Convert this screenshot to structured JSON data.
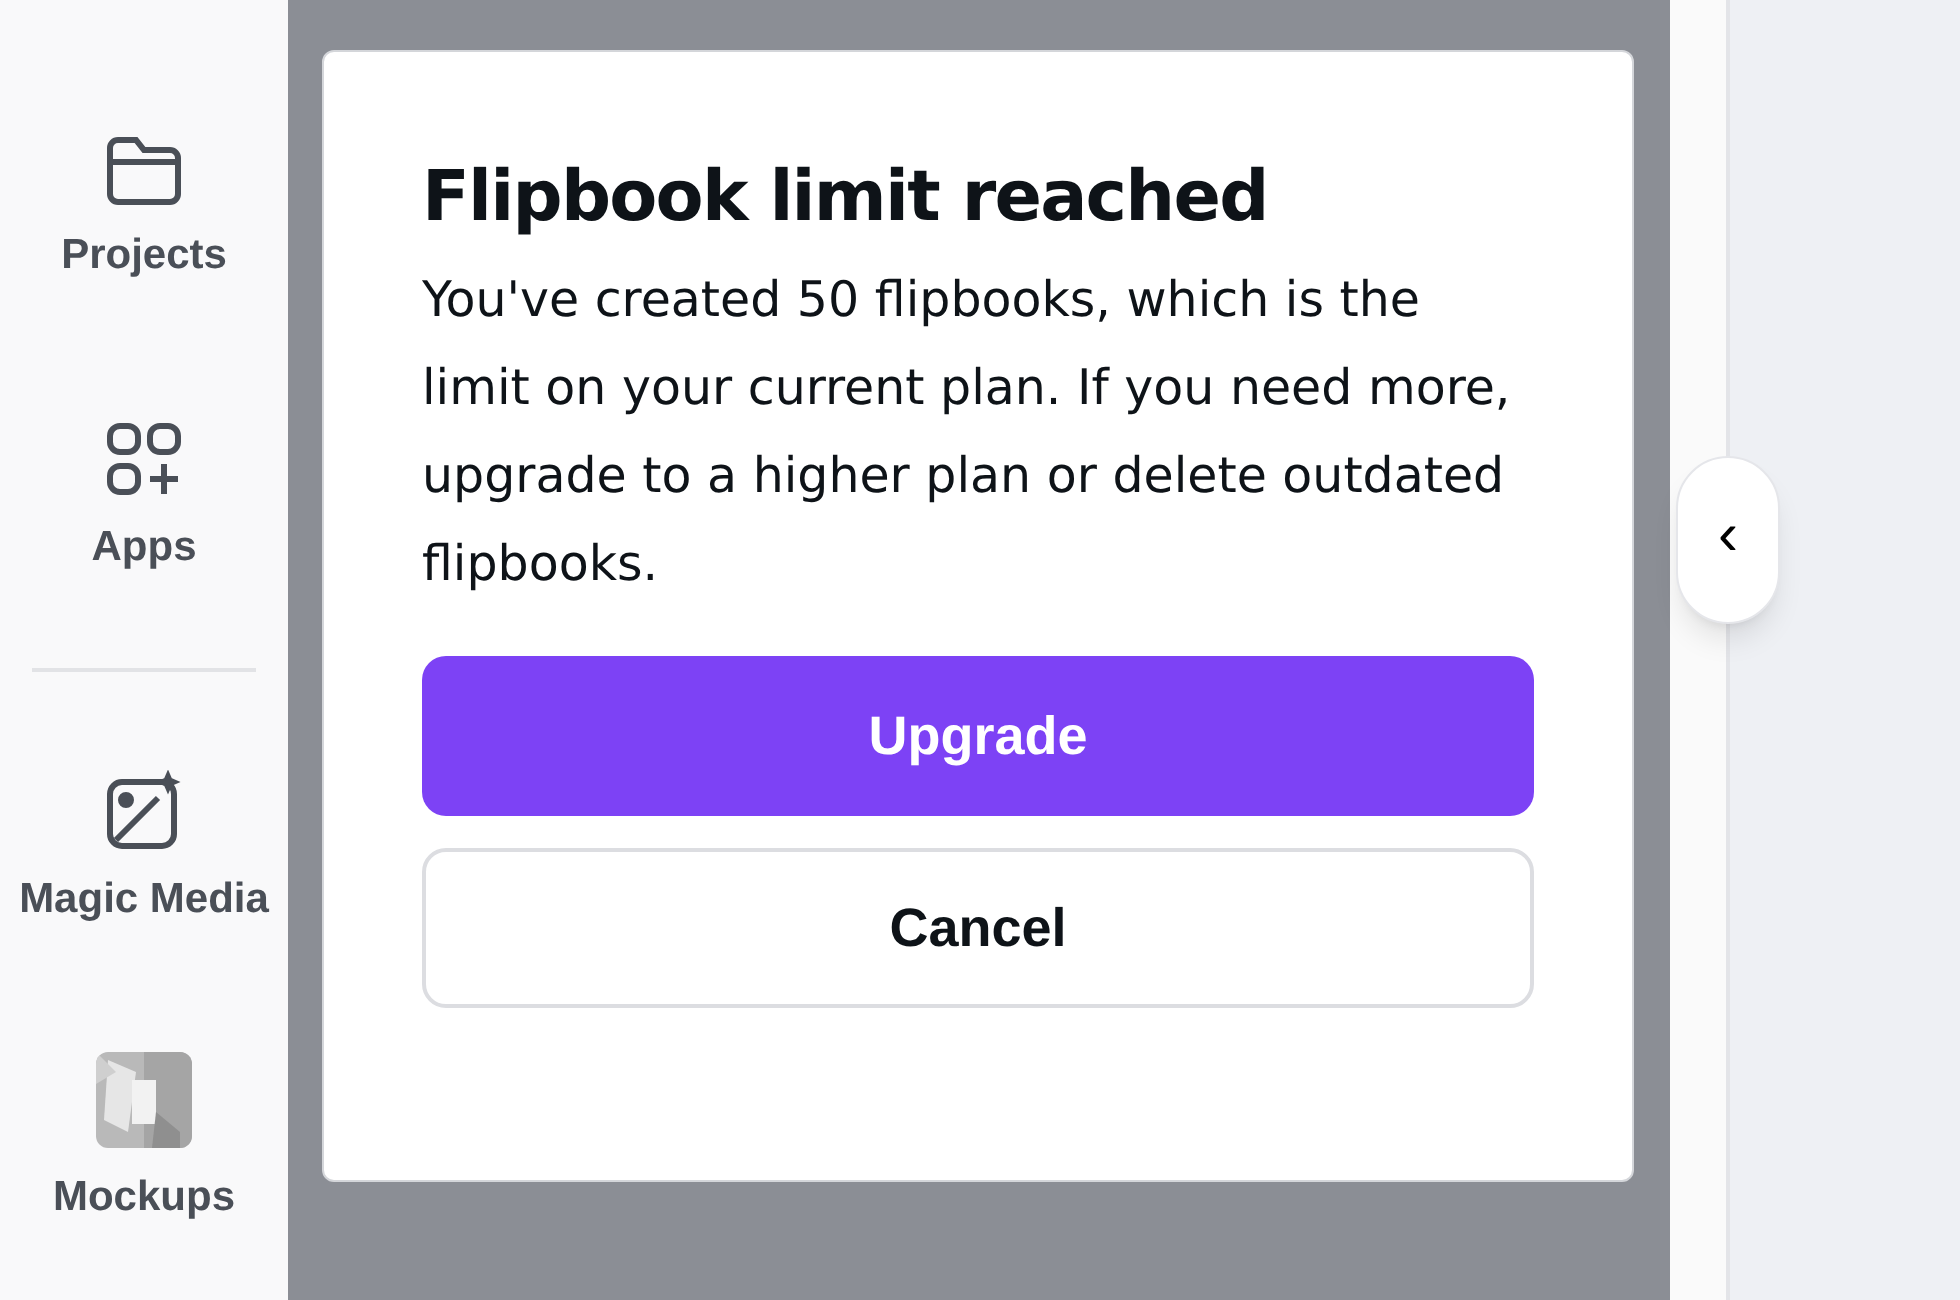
{
  "sidebar": {
    "items": [
      {
        "kind": "folder",
        "label": "Projects"
      },
      {
        "kind": "apps",
        "label": "Apps"
      },
      {
        "kind": "divider"
      },
      {
        "kind": "magic",
        "label": "Magic Media"
      },
      {
        "kind": "picture",
        "label": "Mockups"
      }
    ]
  },
  "dialog": {
    "title": "Flipbook limit reached",
    "message": "You've created 50 flipbooks, which is the limit on your current plan. If you need more, upgrade to a higher plan or delete outdated flipbooks.",
    "buttons": [
      {
        "label": "Upgrade",
        "kind": "primary"
      },
      {
        "label": "Cancel",
        "kind": "secondary"
      }
    ]
  },
  "collapse_button": {
    "glyph": "‹"
  }
}
